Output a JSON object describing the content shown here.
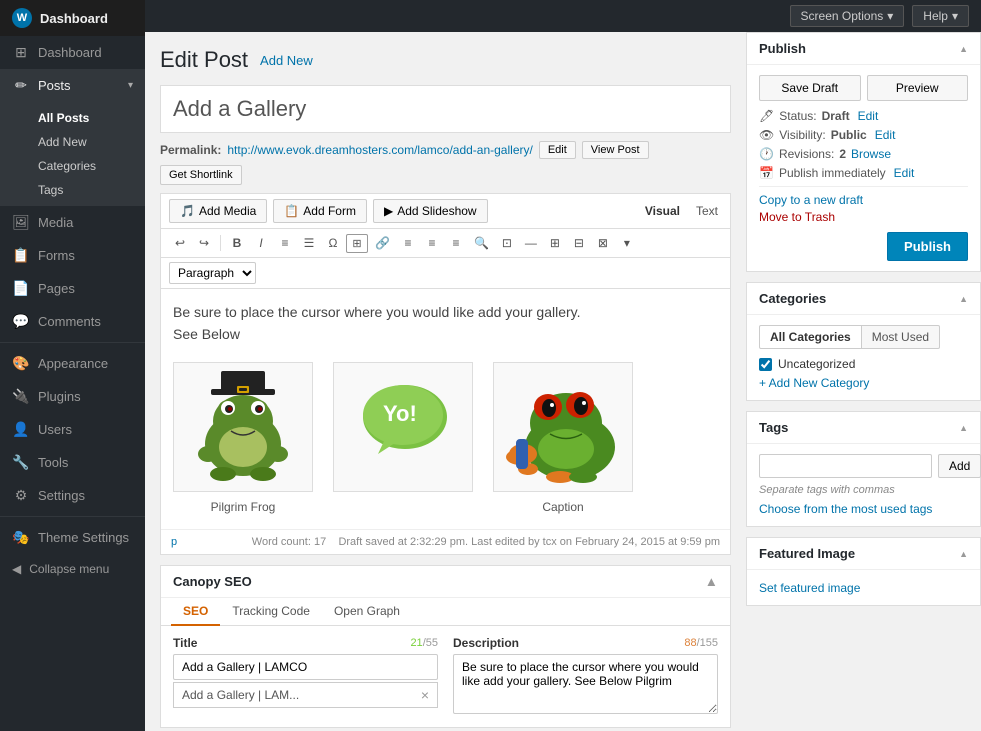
{
  "sidebar": {
    "logo": "Dashboard",
    "items": [
      {
        "id": "dashboard",
        "label": "Dashboard",
        "icon": "⊞",
        "active": false
      },
      {
        "id": "posts",
        "label": "Posts",
        "icon": "📝",
        "active": true
      },
      {
        "id": "media",
        "label": "Media",
        "icon": "🖼",
        "active": false
      },
      {
        "id": "forms",
        "label": "Forms",
        "icon": "📋",
        "active": false
      },
      {
        "id": "pages",
        "label": "Pages",
        "icon": "📄",
        "active": false
      },
      {
        "id": "comments",
        "label": "Comments",
        "icon": "💬",
        "active": false
      },
      {
        "id": "appearance",
        "label": "Appearance",
        "icon": "🎨",
        "active": false
      },
      {
        "id": "plugins",
        "label": "Plugins",
        "icon": "🔌",
        "active": false
      },
      {
        "id": "users",
        "label": "Users",
        "icon": "👤",
        "active": false
      },
      {
        "id": "tools",
        "label": "Tools",
        "icon": "🔧",
        "active": false
      },
      {
        "id": "settings",
        "label": "Settings",
        "icon": "⚙",
        "active": false
      },
      {
        "id": "theme-settings",
        "label": "Theme Settings",
        "icon": "🎭",
        "active": false
      }
    ],
    "posts_sub": [
      {
        "id": "all-posts",
        "label": "All Posts",
        "active": true
      },
      {
        "id": "add-new",
        "label": "Add New",
        "active": false
      },
      {
        "id": "categories",
        "label": "Categories",
        "active": false
      },
      {
        "id": "tags",
        "label": "Tags",
        "active": false
      }
    ],
    "collapse_label": "Collapse menu"
  },
  "topbar": {
    "screen_options": "Screen Options",
    "help": "Help"
  },
  "page": {
    "title": "Edit Post",
    "add_new": "Add New"
  },
  "post": {
    "title": "Add a Gallery",
    "permalink_label": "Permalink:",
    "permalink_url": "http://www.evok.dreamhosters.com/lamco/add-an-gallery/",
    "edit_btn": "Edit",
    "view_btn": "View Post",
    "shortlink_btn": "Get Shortlink"
  },
  "editor": {
    "add_media": "Add Media",
    "add_form": "Add Form",
    "add_slideshow": "Add Slideshow",
    "visual_btn": "Visual",
    "text_btn": "Text",
    "format_options": [
      "Paragraph"
    ],
    "content_line1": "Be sure to place the cursor where you would like add your gallery.",
    "content_line2": "See Below",
    "gallery": [
      {
        "id": "pilgrim-frog",
        "caption": "Pilgrim Frog"
      },
      {
        "id": "yo-frog",
        "caption": ""
      },
      {
        "id": "red-eye-frog",
        "caption": "Caption"
      }
    ],
    "word_count_label": "Word count: 17",
    "draft_saved": "Draft saved at 2:32:29 pm. Last edited by tcx on February 24, 2015 at 9:59 pm"
  },
  "seo": {
    "title": "Canopy SEO",
    "tabs": [
      {
        "id": "seo",
        "label": "SEO",
        "active": true
      },
      {
        "id": "tracking",
        "label": "Tracking Code",
        "active": false
      },
      {
        "id": "opengraph",
        "label": "Open Graph",
        "active": false
      }
    ],
    "title_label": "Title",
    "title_count": "21",
    "title_max": "55",
    "description_label": "Description",
    "desc_count": "88",
    "desc_max": "155",
    "title_value": "Add a Gallery | LAMCO",
    "description_value": "Be sure to place the cursor where you would like add your gallery. See Below Pilgrim",
    "autocomplete_text": "Add a Gallery | LAM...",
    "autocomplete_close": "×"
  },
  "publish": {
    "title": "Publish",
    "save_draft": "Save Draft",
    "preview": "Preview",
    "status_label": "Status:",
    "status_value": "Draft",
    "status_edit": "Edit",
    "visibility_label": "Visibility:",
    "visibility_value": "Public",
    "visibility_edit": "Edit",
    "revisions_label": "Revisions:",
    "revisions_value": "2",
    "browse_label": "Browse",
    "publish_immediately": "Publish immediately",
    "publish_edit": "Edit",
    "copy_draft": "Copy to a new draft",
    "move_trash": "Move to Trash",
    "publish_btn": "Publish"
  },
  "categories": {
    "title": "Categories",
    "tab_all": "All Categories",
    "tab_most_used": "Most Used",
    "uncategorized_checked": true,
    "uncategorized_label": "Uncategorized",
    "add_new_label": "+ Add New Category"
  },
  "tags": {
    "title": "Tags",
    "input_placeholder": "",
    "add_btn": "Add",
    "hint": "Separate tags with commas",
    "choose_link": "Choose from the most used tags"
  },
  "featured_image": {
    "title": "Featured Image",
    "set_link": "Set featured image"
  }
}
